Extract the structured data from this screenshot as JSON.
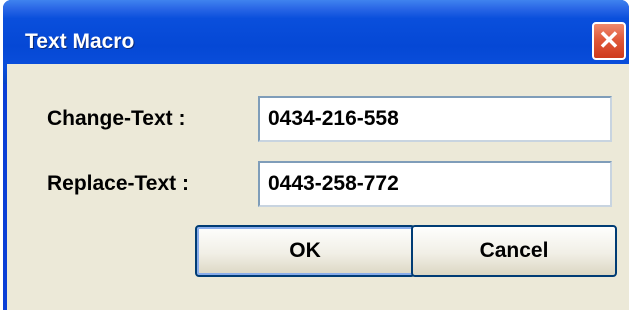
{
  "window": {
    "title": "Text Macro",
    "close_glyph": "✕",
    "close_icon": "close-icon"
  },
  "form": {
    "change_label": "Change-Text :",
    "change_value": "0434-216-558",
    "replace_label": "Replace-Text :",
    "replace_value": "0443-258-772"
  },
  "buttons": {
    "ok_label": "OK",
    "cancel_label": "Cancel"
  },
  "colors": {
    "titlebar": "#0548d5",
    "client_background": "#ece9d8",
    "close_button": "#e0593a",
    "button_border": "#003c74"
  }
}
